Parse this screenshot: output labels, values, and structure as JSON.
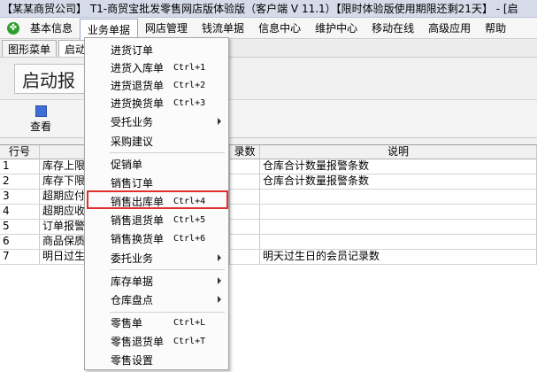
{
  "titlebar": {
    "text": "【某某商贸公司】 T1-商贸宝批发零售网店版体验版（客户端 V 11.1）【限时体验版使用期限还剩21天】 - [启"
  },
  "menubar": {
    "logo": "✤",
    "items": [
      "基本信息",
      "业务单据",
      "网店管理",
      "钱流单据",
      "信息中心",
      "维护中心",
      "移动在线",
      "高级应用",
      "帮助"
    ]
  },
  "tabs": [
    "图形菜单",
    "启动"
  ],
  "banner": {
    "text": "启动报"
  },
  "toolbar": {
    "view_label": "查看"
  },
  "grid": {
    "columns": {
      "no": "行号",
      "name": "",
      "count": "录数",
      "desc": "说明"
    },
    "rows": [
      {
        "no": "1",
        "name": "库存上限",
        "count": "",
        "desc": "仓库合计数量报警条数"
      },
      {
        "no": "2",
        "name": "库存下限",
        "count": "",
        "desc": "仓库合计数量报警条数"
      },
      {
        "no": "3",
        "name": "超期应付",
        "count": "",
        "desc": ""
      },
      {
        "no": "4",
        "name": "超期应收",
        "count": "",
        "desc": ""
      },
      {
        "no": "5",
        "name": "订单报警",
        "count": "",
        "desc": ""
      },
      {
        "no": "6",
        "name": "商品保质",
        "count": "",
        "desc": ""
      },
      {
        "no": "7",
        "name": "明日过生",
        "count": "",
        "desc": "明天过生日的会员记录数"
      }
    ]
  },
  "dropdown": {
    "items": [
      {
        "label": "进货订单",
        "shortcut": ""
      },
      {
        "label": "进货入库单",
        "shortcut": "Ctrl+1"
      },
      {
        "label": "进货退货单",
        "shortcut": "Ctrl+2"
      },
      {
        "label": "进货换货单",
        "shortcut": "Ctrl+3"
      },
      {
        "label": "受托业务",
        "shortcut": "",
        "submenu": true
      },
      {
        "label": "采购建议",
        "shortcut": ""
      },
      {
        "label": "促销单",
        "shortcut": ""
      },
      {
        "label": "销售订单",
        "shortcut": ""
      },
      {
        "label": "销售出库单",
        "shortcut": "Ctrl+4",
        "highlighted": true
      },
      {
        "label": "销售退货单",
        "shortcut": "Ctrl+5"
      },
      {
        "label": "销售换货单",
        "shortcut": "Ctrl+6"
      },
      {
        "label": "委托业务",
        "shortcut": "",
        "submenu": true
      },
      {
        "label": "库存单据",
        "shortcut": "",
        "submenu": true
      },
      {
        "label": "仓库盘点",
        "shortcut": "",
        "submenu": true
      },
      {
        "label": "零售单",
        "shortcut": "Ctrl+L"
      },
      {
        "label": "零售退货单",
        "shortcut": "Ctrl+T"
      },
      {
        "label": "零售设置",
        "shortcut": ""
      }
    ]
  },
  "colors": {
    "highlight_border": "#e03030",
    "logo": "#2f9e2f",
    "view_icon": "#3f6fd6"
  }
}
